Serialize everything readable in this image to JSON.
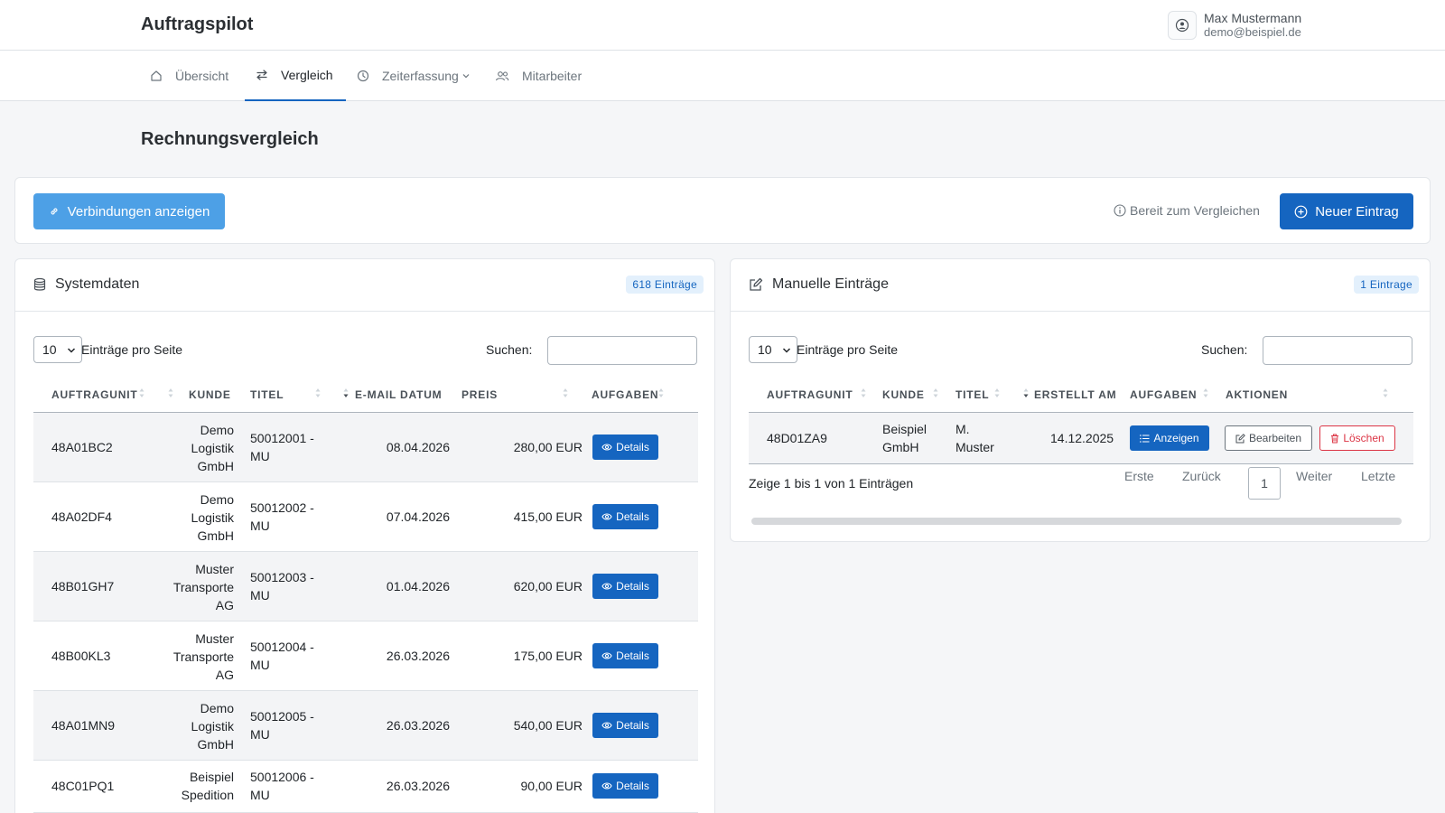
{
  "app": {
    "title": "Auftragspilot"
  },
  "user": {
    "name": "Max Mustermann",
    "email": "demo@beispiel.de"
  },
  "nav": {
    "items": [
      {
        "label": "Übersicht",
        "icon": "home-icon"
      },
      {
        "label": "Vergleich",
        "icon": "swap-icon",
        "active": true
      },
      {
        "label": "Zeiterfassung",
        "icon": "clock-icon",
        "dropdown": true
      },
      {
        "label": "Mitarbeiter",
        "icon": "users-icon"
      }
    ]
  },
  "page": {
    "title": "Rechnungsvergleich"
  },
  "toolbar": {
    "connections_label": "Verbindungen anzeigen",
    "status_text": "Bereit zum Vergleichen",
    "new_label": "Neuer Eintrag"
  },
  "system": {
    "title": "Systemdaten",
    "count": "618 Einträge",
    "page_length": "10",
    "length_label": "Einträge pro Seite",
    "search_label": "Suchen:",
    "search_value": "",
    "columns": [
      "AUFTRAGUNIT",
      "KUNDE",
      "TITEL",
      "E-MAIL DATUM",
      "PREIS",
      "AUFGABEN"
    ],
    "details_label": "Details",
    "rows": [
      {
        "unit": "48A01BC2",
        "kunde": [
          "Demo",
          "Logistik",
          "GmbH"
        ],
        "titel": [
          "50012001 -",
          "MU"
        ],
        "datum": "08.04.2026",
        "preis": "280,00 EUR"
      },
      {
        "unit": "48A02DF4",
        "kunde": [
          "Demo",
          "Logistik",
          "GmbH"
        ],
        "titel": [
          "50012002 -",
          "MU"
        ],
        "datum": "07.04.2026",
        "preis": "415,00 EUR"
      },
      {
        "unit": "48B01GH7",
        "kunde": [
          "Muster",
          "Transporte",
          "AG"
        ],
        "titel": [
          "50012003 -",
          "MU"
        ],
        "datum": "01.04.2026",
        "preis": "620,00 EUR"
      },
      {
        "unit": "48B00KL3",
        "kunde": [
          "Muster",
          "Transporte",
          "AG"
        ],
        "titel": [
          "50012004 -",
          "MU"
        ],
        "datum": "26.03.2026",
        "preis": "175,00 EUR"
      },
      {
        "unit": "48A01MN9",
        "kunde": [
          "Demo",
          "Logistik",
          "GmbH"
        ],
        "titel": [
          "50012005 -",
          "MU"
        ],
        "datum": "26.03.2026",
        "preis": "540,00 EUR"
      },
      {
        "unit": "48C01PQ1",
        "kunde": [
          "Beispiel",
          "Spedition"
        ],
        "titel": [
          "50012006 -",
          "MU"
        ],
        "datum": "26.03.2026",
        "preis": "90,00 EUR"
      }
    ]
  },
  "manual": {
    "title": "Manuelle Einträge",
    "count": "1 Eintrage",
    "page_length": "10",
    "length_label": "Einträge pro Seite",
    "search_label": "Suchen:",
    "search_value": "",
    "columns": [
      "AUFTRAGUNIT",
      "KUNDE",
      "TITEL",
      "ERSTELLT AM",
      "AUFGABEN",
      "AKTIONEN"
    ],
    "rows": [
      {
        "unit": "48D01ZA9",
        "kunde": [
          "Beispiel",
          "GmbH"
        ],
        "titel": [
          "M.",
          "Muster"
        ],
        "erstellt": "14.12.2025"
      }
    ],
    "show_label": "Anzeigen",
    "edit_label": "Bearbeiten",
    "delete_label": "Löschen",
    "info": "Zeige 1 bis 1 von 1 Einträgen",
    "pagination": {
      "first": "Erste",
      "prev": "Zurück",
      "current": "1",
      "next": "Weiter",
      "last": "Letzte"
    }
  },
  "colors": {
    "primary": "#1565c0",
    "light_primary": "#4da0e6",
    "danger": "#dc3545"
  }
}
